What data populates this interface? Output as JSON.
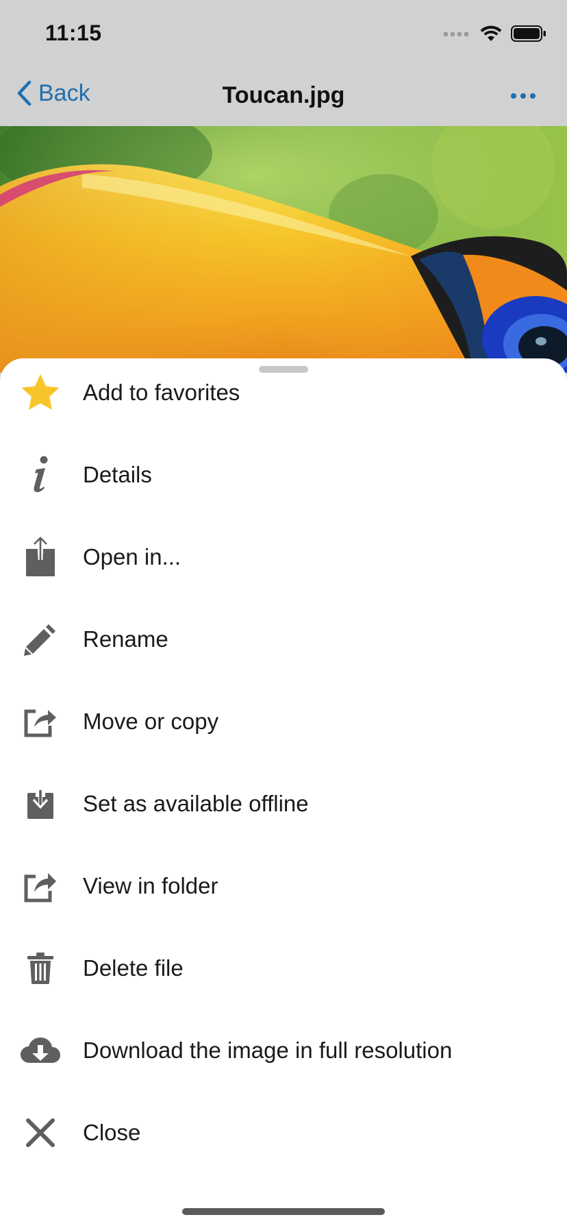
{
  "status_bar": {
    "time": "11:15"
  },
  "nav": {
    "back_label": "Back",
    "title": "Toucan.jpg"
  },
  "colors": {
    "accent": "#1f6fb0",
    "icon_gray": "#5f5f5f",
    "star": "#f7c52b"
  },
  "menu": {
    "items": [
      {
        "label": "Add to favorites",
        "icon": "star-icon"
      },
      {
        "label": "Details",
        "icon": "info-icon"
      },
      {
        "label": "Open in...",
        "icon": "share-icon"
      },
      {
        "label": "Rename",
        "icon": "pencil-icon"
      },
      {
        "label": "Move or copy",
        "icon": "external-arrow-icon"
      },
      {
        "label": "Set as available offline",
        "icon": "download-tray-icon"
      },
      {
        "label": "View in folder",
        "icon": "external-arrow-icon"
      },
      {
        "label": "Delete file",
        "icon": "trash-icon"
      },
      {
        "label": "Download the image in full resolution",
        "icon": "cloud-download-icon"
      },
      {
        "label": "Close",
        "icon": "close-icon"
      }
    ]
  }
}
